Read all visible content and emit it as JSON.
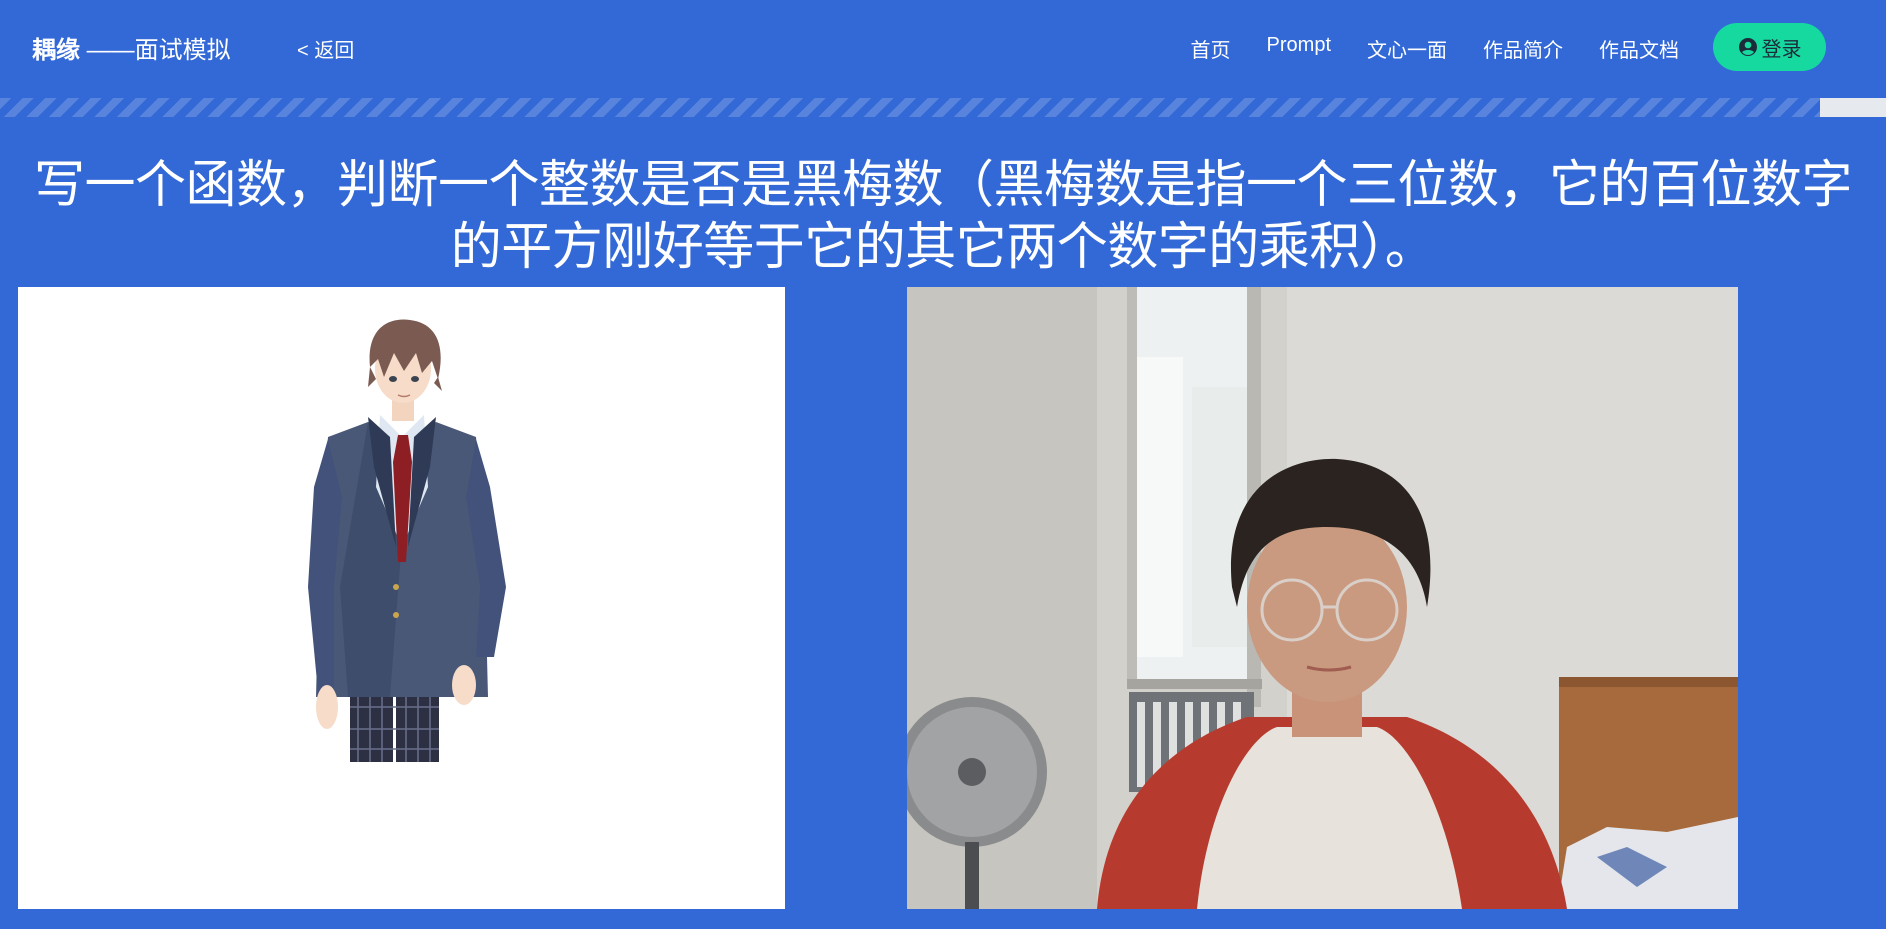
{
  "header": {
    "brand": "耦缘",
    "brand_suffix": " ——面试模拟",
    "back_label": "< 返回",
    "nav": [
      {
        "label": "首页"
      },
      {
        "label": "Prompt"
      },
      {
        "label": "文心一面"
      },
      {
        "label": "作品简介"
      },
      {
        "label": "作品文档"
      }
    ],
    "login_label": "登录",
    "login_icon": "user-circle-icon"
  },
  "question": {
    "text": "写一个函数，判断一个整数是否是黑梅数（黑梅数是指一个三位数，它的百位数字的平方刚好等于它的其它两个数字的乘积）。"
  },
  "panels": {
    "avatar": "anime-interviewer-avatar",
    "camera": "webcam-feed"
  },
  "colors": {
    "background": "#3369d6",
    "login_button": "#16d9a0",
    "panel": "#ffffff"
  }
}
